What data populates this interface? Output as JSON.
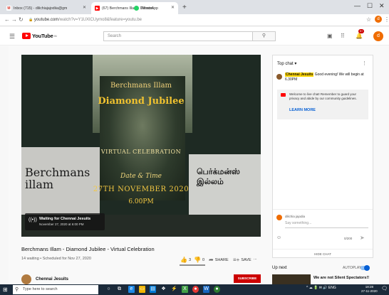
{
  "browser": {
    "tabs": [
      {
        "title": "Inbox (715) - dilichiajajodiia@gm",
        "icon": "gmail-icon",
        "color": "#d93025",
        "active": false
      },
      {
        "title": "(67) Berchmans Illam - Diamon",
        "icon": "youtube-icon",
        "color": "#ff0000",
        "active": true
      },
      {
        "title": "WhatsApp",
        "icon": "whatsapp-icon",
        "color": "#25d366",
        "active": false
      }
    ],
    "new_tab": "+",
    "url_main": "youtube.com",
    "url_rest": "/watch?v=Y1UXlCUymo8&feature=youtu.be",
    "profile_initial": "d"
  },
  "youtube": {
    "logo": "YouTube",
    "logo_region": "IN",
    "search_placeholder": "Search",
    "notification_count": "9+",
    "avatar_initial": "d"
  },
  "video": {
    "overlay": {
      "line1": "Berchmans Illam",
      "line2": "Diamond Jubilee",
      "virtual": "VIRTUAL CELEBRATION",
      "date_time": "Date & Time",
      "date": "27TH NOVEMBER 2020",
      "time": "6.00PM",
      "sign_english": "Berchmans illam",
      "sign_tamil": "பெர்க்மன்ஸ் இல்லம்"
    },
    "waiting_title": "Waiting for Chennai Jesuits",
    "waiting_sub": "November 27, 2020 at 6:00 PM",
    "title": "Berchmans Illam - Diamond Jubilee - Virtual Celebration",
    "meta": "14 waiting • Scheduled for Nov 27, 2020",
    "likes": "3",
    "dislikes": "0",
    "share": "SHARE",
    "save": "SAVE",
    "more": "...",
    "like_ratio": 1.0,
    "channel": "Chennai Jesuits",
    "subscribe": "SUBSCRIBE"
  },
  "chat": {
    "header": "Top chat ▾",
    "more": "⋮",
    "message_author": "Chennai Jesuits",
    "message_text": "Good evening! We will begin at 6.30PM",
    "notice": "Welcome to live chat! Remember to guard your privacy and abide by our community guidelines.",
    "learn_more": "LEARN MORE",
    "user_name": "dilichia jajodia",
    "input_placeholder": "Say something...",
    "char_count": "0/200",
    "hide_chat": "HIDE CHAT"
  },
  "upnext": {
    "label": "Up next",
    "autoplay": "AUTOPLAY",
    "next_title": "We are not Silent Spectators!!"
  },
  "taskbar": {
    "search": "Type here to search",
    "tray": "^ ☁ 🔋 ✉ 🔊 ENG",
    "time": "18:28",
    "date": "27-11-2020"
  }
}
